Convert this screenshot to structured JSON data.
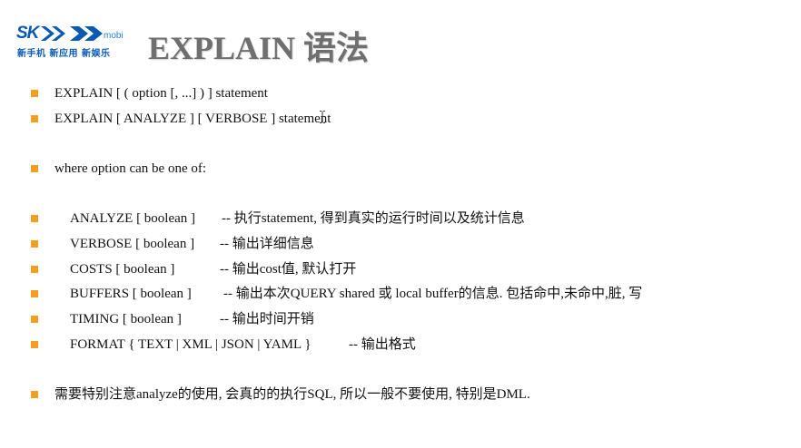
{
  "logo": {
    "brand_text": "SK",
    "brand_suffix": "mobi",
    "tagline": "新手机 新应用 新娱乐",
    "brand_color": "#0a5ab4"
  },
  "title": "EXPLAIN 语法",
  "bullet_color": "#f0a020",
  "lines": {
    "syntax1": "EXPLAIN [ ( option [, ...] ) ] statement",
    "syntax2": "EXPLAIN [ ANALYZE ] [ VERBOSE ] statement",
    "where": "where option can be one of:",
    "note": "需要特别注意analyze的使用, 会真的的执行SQL, 所以一般不要使用, 特别是DML."
  },
  "options": [
    {
      "name": "ANALYZE [ boolean ]",
      "desc": "-- 执行statement, 得到真实的运行时间以及统计信息"
    },
    {
      "name": "VERBOSE [ boolean ]",
      "desc": "-- 输出详细信息"
    },
    {
      "name": "COSTS [ boolean ]",
      "desc": "-- 输出cost值, 默认打开"
    },
    {
      "name": "BUFFERS [ boolean ]",
      "desc": "-- 输出本次QUERY shared 或 local buffer的信息. 包括命中,未命中,脏, 写"
    },
    {
      "name": "TIMING [ boolean ]",
      "desc": "-- 输出时间开销"
    },
    {
      "name": "FORMAT { TEXT | XML | JSON | YAML }",
      "desc": "-- 输出格式"
    }
  ]
}
